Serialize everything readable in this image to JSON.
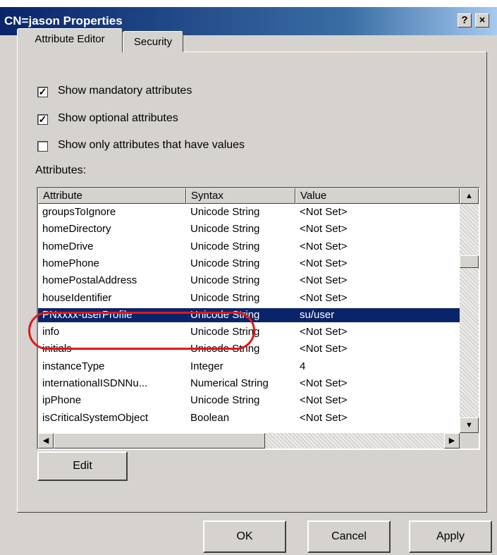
{
  "window": {
    "title": "CN=jason Properties",
    "help_glyph": "?",
    "close_glyph": "×"
  },
  "tabs": [
    {
      "label": "Attribute Editor",
      "active": true
    },
    {
      "label": "Security",
      "active": false
    }
  ],
  "options": [
    {
      "label": "Show mandatory attributes",
      "checked": true
    },
    {
      "label": "Show optional attributes",
      "checked": true
    },
    {
      "label": "Show only attributes that have values",
      "checked": false
    }
  ],
  "attributes_label": "Attributes:",
  "table": {
    "columns": [
      "Attribute",
      "Syntax",
      "Value"
    ],
    "rows": [
      [
        "groupsToIgnore",
        "Unicode String",
        "<Not Set>"
      ],
      [
        "homeDirectory",
        "Unicode String",
        "<Not Set>"
      ],
      [
        "homeDrive",
        "Unicode String",
        "<Not Set>"
      ],
      [
        "homePhone",
        "Unicode String",
        "<Not Set>"
      ],
      [
        "homePostalAddress",
        "Unicode String",
        "<Not Set>"
      ],
      [
        "houseIdentifier",
        "Unicode String",
        "<Not Set>"
      ],
      [
        "PNxxxx-userProfile",
        "Unicode String",
        "su/user"
      ],
      [
        "info",
        "Unicode String",
        "<Not Set>"
      ],
      [
        "initials",
        "Unicode String",
        "<Not Set>"
      ],
      [
        "instanceType",
        "Integer",
        "4"
      ],
      [
        "internationalISDNNu...",
        "Numerical String",
        "<Not Set>"
      ],
      [
        "ipPhone",
        "Unicode String",
        "<Not Set>"
      ],
      [
        "isCriticalSystemObject",
        "Boolean",
        "<Not Set>"
      ]
    ],
    "selected_row": 6
  },
  "scroll": {
    "up": "▲",
    "down": "▼",
    "left": "◀",
    "right": "▶"
  },
  "buttons": {
    "edit": "Edit",
    "ok": "OK",
    "cancel": "Cancel",
    "apply": "Apply"
  },
  "colors": {
    "selection": "#0a246a",
    "highlight_oval": "#e01818",
    "dialog_bg": "#d6d3ce"
  }
}
